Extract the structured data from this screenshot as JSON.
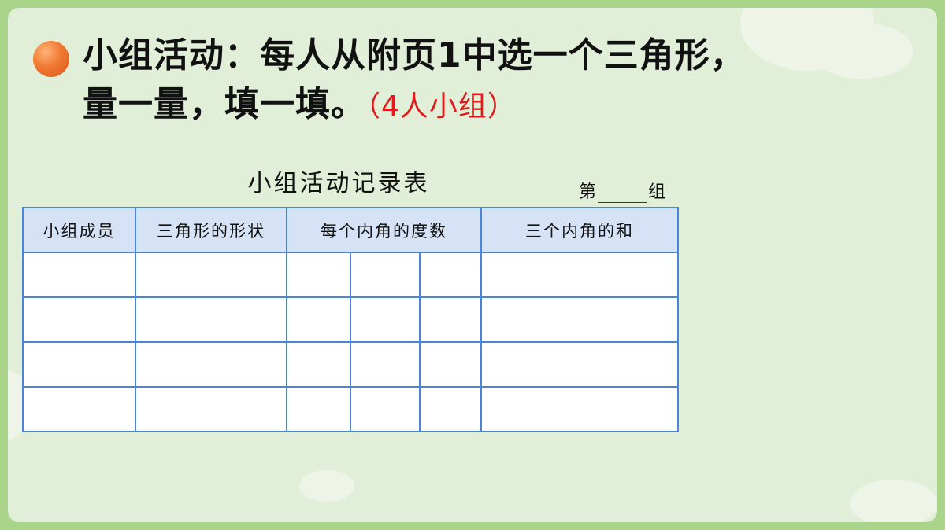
{
  "heading": {
    "line1": "小组活动：每人从附页1中选一个三角形，",
    "line2": "量一量，填一填。",
    "note": "（4人小组）"
  },
  "table": {
    "title": "小组活动记录表",
    "group_prefix": "第",
    "group_suffix": "组",
    "headers": [
      "小组成员",
      "三角形的形状",
      "每个内角的度数",
      "三个内角的和"
    ],
    "row_count": 4
  }
}
